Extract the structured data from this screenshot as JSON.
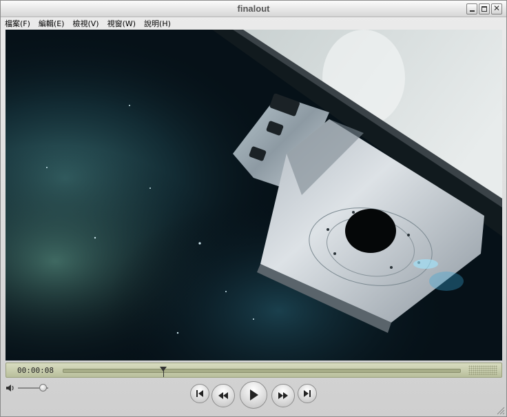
{
  "window": {
    "title": "finalout"
  },
  "window_buttons": {
    "minimize": "minimize-icon",
    "maximize": "maximize-icon",
    "close": "close-icon",
    "close_glyph": "✕"
  },
  "menu": [
    {
      "label": "檔案(F)"
    },
    {
      "label": "編輯(E)"
    },
    {
      "label": "檢視(V)"
    },
    {
      "label": "視窗(W)"
    },
    {
      "label": "說明(H)"
    }
  ],
  "timeline": {
    "timecode": "00:00:08",
    "position_fraction": 0.25
  },
  "volume": {
    "level_fraction": 0.82
  },
  "transport": {
    "prev": "skip-to-start-icon",
    "rewind": "rewind-icon",
    "play": "play-icon",
    "fast_forward": "fast-forward-icon",
    "next": "skip-to-end-icon"
  },
  "colors": {
    "video_bg": "#061118",
    "timeline": "#c7cba9"
  }
}
